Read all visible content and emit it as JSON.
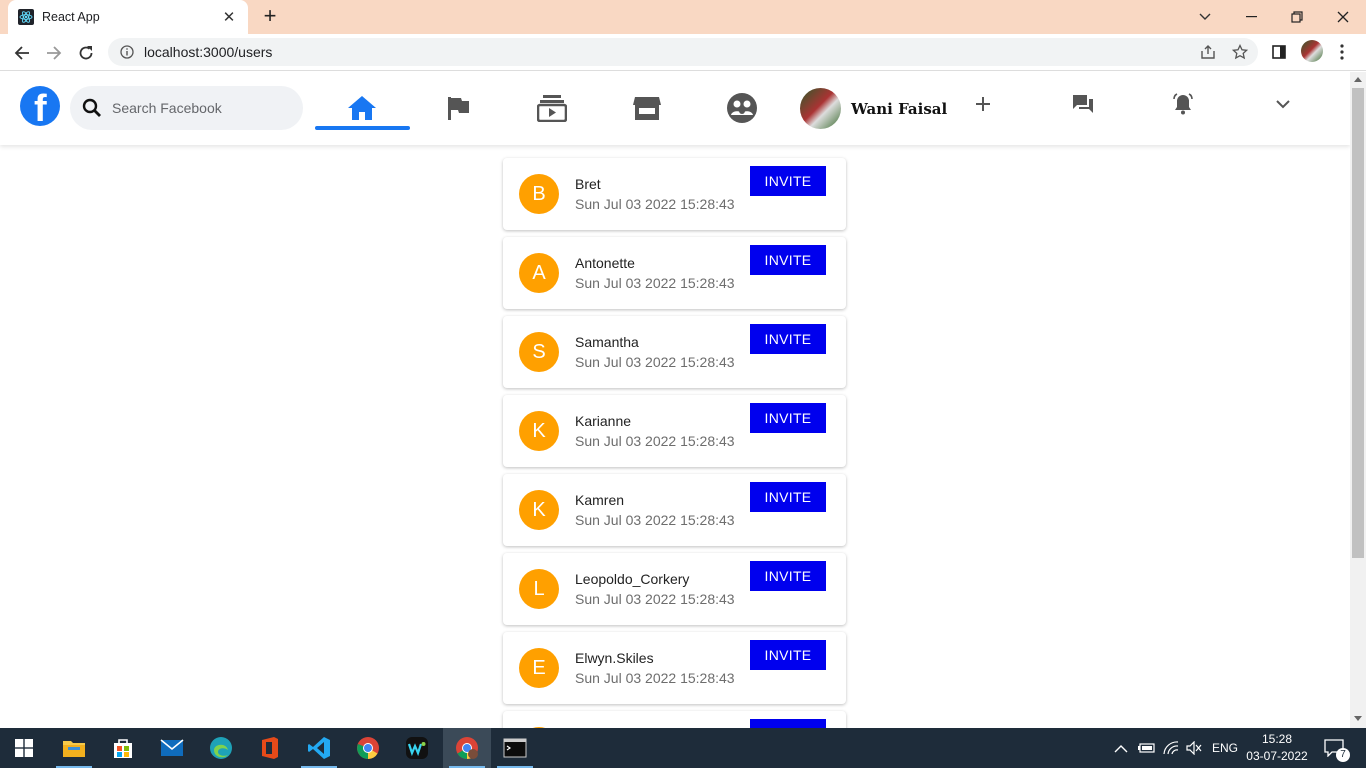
{
  "browser": {
    "tab_title": "React App",
    "url": "localhost:3000/users"
  },
  "header": {
    "search_placeholder": "Search Facebook",
    "profile_name": "Wani Faisal"
  },
  "users": [
    {
      "initial": "B",
      "name": "Bret",
      "date": "Sun Jul 03 2022 15:28:43",
      "action": "INVITE"
    },
    {
      "initial": "A",
      "name": "Antonette",
      "date": "Sun Jul 03 2022 15:28:43",
      "action": "INVITE"
    },
    {
      "initial": "S",
      "name": "Samantha",
      "date": "Sun Jul 03 2022 15:28:43",
      "action": "INVITE"
    },
    {
      "initial": "K",
      "name": "Karianne",
      "date": "Sun Jul 03 2022 15:28:43",
      "action": "INVITE"
    },
    {
      "initial": "K",
      "name": "Kamren",
      "date": "Sun Jul 03 2022 15:28:43",
      "action": "INVITE"
    },
    {
      "initial": "L",
      "name": "Leopoldo_Corkery",
      "date": "Sun Jul 03 2022 15:28:43",
      "action": "INVITE"
    },
    {
      "initial": "E",
      "name": "Elwyn.Skiles",
      "date": "Sun Jul 03 2022 15:28:43",
      "action": "INVITE"
    },
    {
      "initial": "",
      "name": "",
      "date": "",
      "action": ""
    }
  ],
  "taskbar": {
    "language": "ENG",
    "time": "15:28",
    "date": "03-07-2022",
    "notification_count": "7"
  },
  "colors": {
    "fb_blue": "#1877f2",
    "avatar_orange": "#ffa000",
    "invite_blue": "#0000ee"
  }
}
